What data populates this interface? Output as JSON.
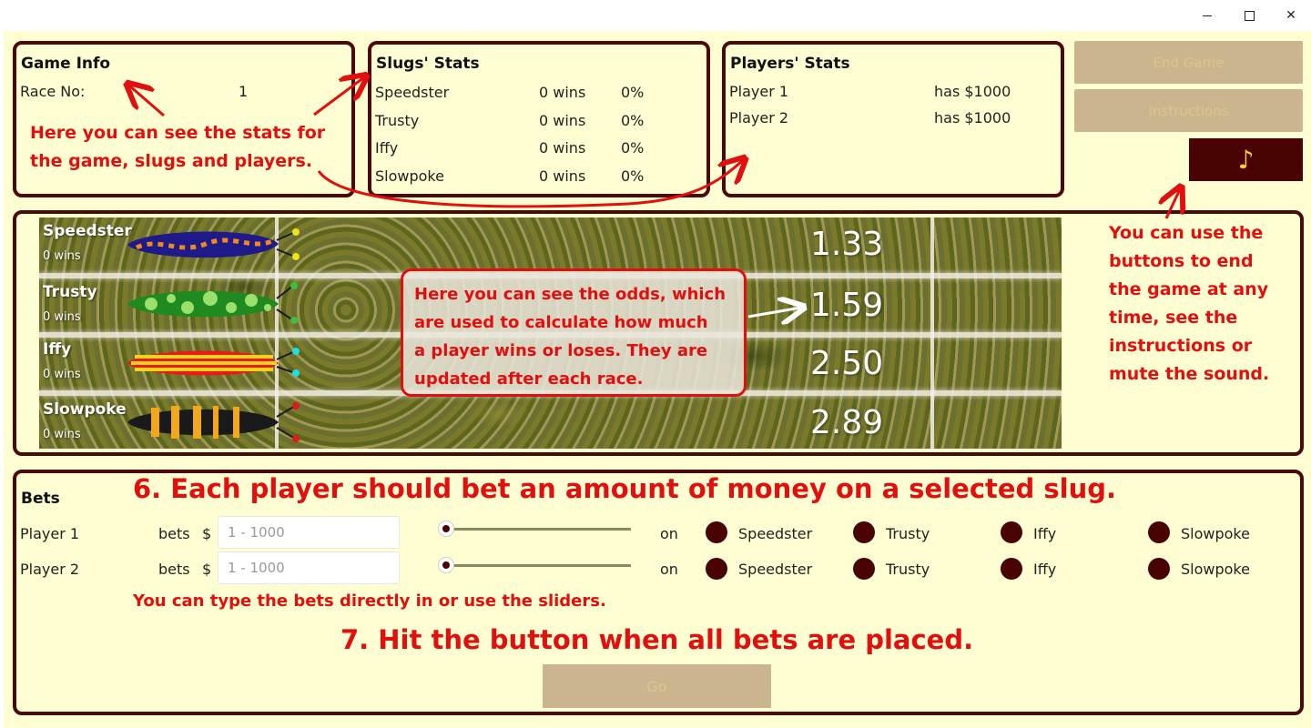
{
  "window": {
    "minimize": "",
    "maximize": "",
    "close": "✕"
  },
  "game_info": {
    "title": "Game Info",
    "race_label": "Race No:",
    "race_value": "1"
  },
  "slugs_stats": {
    "title": "Slugs' Stats",
    "rows": [
      {
        "name": "Speedster",
        "wins": "0 wins",
        "pct": "0%"
      },
      {
        "name": "Trusty",
        "wins": "0 wins",
        "pct": "0%"
      },
      {
        "name": "Iffy",
        "wins": "0 wins",
        "pct": "0%"
      },
      {
        "name": "Slowpoke",
        "wins": "0 wins",
        "pct": "0%"
      }
    ]
  },
  "players_stats": {
    "title": "Players' Stats",
    "rows": [
      {
        "name": "Player 1",
        "money": "has $1000"
      },
      {
        "name": "Player 2",
        "money": "has $1000"
      }
    ]
  },
  "buttons": {
    "end_game": "End Game",
    "instructions": "Instructions",
    "music": "♪",
    "go": "Go"
  },
  "callouts": {
    "stats_line1": "Here you can see the stats for",
    "stats_line2": "the game, slugs and players.",
    "buttons_lines": [
      "You can use the",
      "buttons to end",
      "the game at any",
      "time, see the",
      "instructions or",
      "mute the sound."
    ],
    "odds_lines": [
      "Here you can see the odds, which",
      "are used to calculate how much",
      "a player wins or loses. They are",
      "updated after each race."
    ],
    "bet_heading": "6. Each player should bet an amount of money on a selected slug.",
    "type_hint": "You can type the bets directly in or use the sliders.",
    "go_heading": "7. Hit the button when all bets are placed."
  },
  "track": {
    "slugs": [
      {
        "name": "Speedster",
        "wins": "0 wins",
        "odds": "1.33",
        "body_color": "#1f1a8a",
        "pattern_color": "#f08a1a",
        "antenna_color": "#f2e21a"
      },
      {
        "name": "Trusty",
        "wins": "0 wins",
        "odds": "1.59",
        "body_color": "#1f8a1f",
        "pattern_color": "#9ae06a",
        "antenna_color": "#3fbf3f"
      },
      {
        "name": "Iffy",
        "wins": "0 wins",
        "odds": "2.50",
        "body_color": "#e81a1a",
        "pattern_color": "#f2d21a",
        "antenna_color": "#1ae0e8"
      },
      {
        "name": "Slowpoke",
        "wins": "0 wins",
        "odds": "2.89",
        "body_color": "#1a1a1a",
        "pattern_color": "#f2a81a",
        "antenna_color": "#e01a1a"
      }
    ]
  },
  "bets": {
    "title": "Bets",
    "players": [
      {
        "name": "Player 1",
        "bets_label": "bets",
        "currency": "$",
        "placeholder": "1 - 1000",
        "on_label": "on",
        "slider_value": 0
      },
      {
        "name": "Player 2",
        "bets_label": "bets",
        "currency": "$",
        "placeholder": "1 - 1000",
        "on_label": "on",
        "slider_value": 0
      }
    ],
    "options": [
      "Speedster",
      "Trusty",
      "Iffy",
      "Slowpoke"
    ]
  },
  "colors": {
    "panel_border": "#4a0a0a",
    "background": "#fffdd2",
    "callout": "#e20f0f",
    "button": "#cbb58e"
  }
}
